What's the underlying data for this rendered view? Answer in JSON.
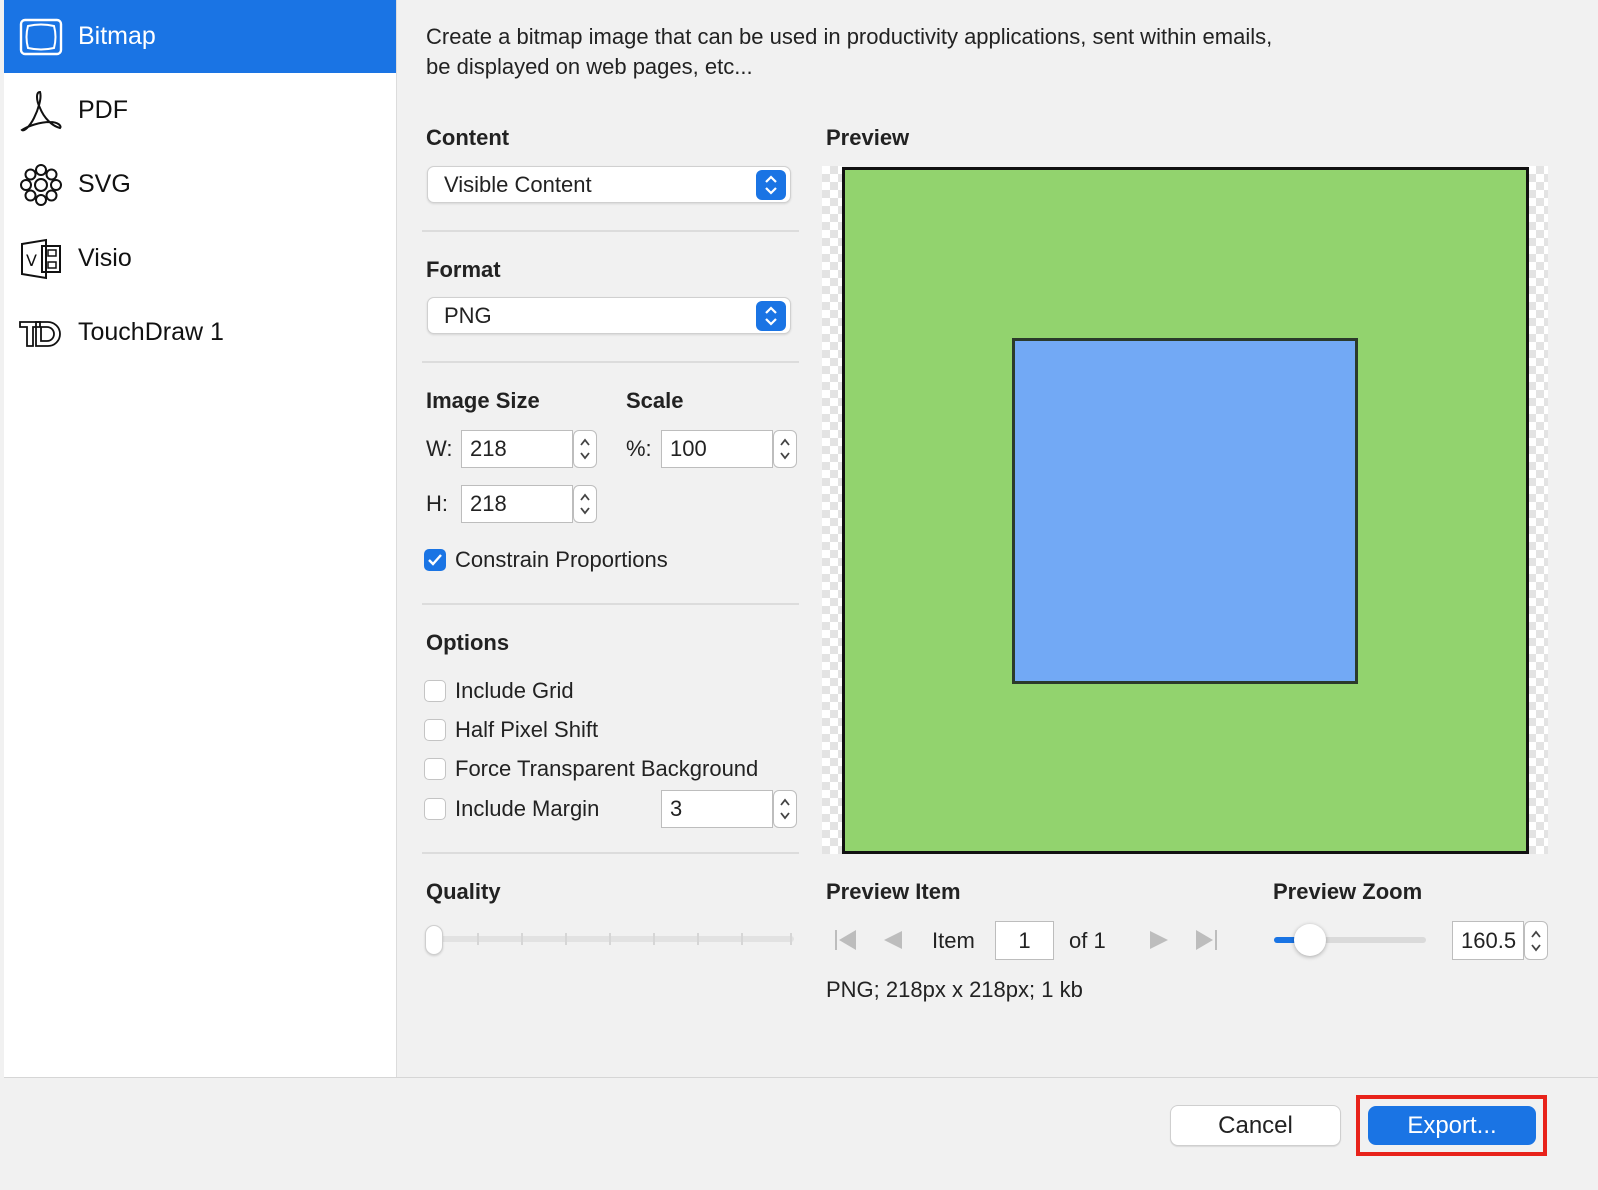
{
  "sidebar": {
    "items": [
      {
        "label": "Bitmap",
        "icon": "bitmap-frame-icon",
        "active": true
      },
      {
        "label": "PDF",
        "icon": "pdf-icon",
        "active": false
      },
      {
        "label": "SVG",
        "icon": "svg-icon",
        "active": false
      },
      {
        "label": "Visio",
        "icon": "visio-icon",
        "active": false
      },
      {
        "label": "TouchDraw 1",
        "icon": "touchdraw-icon",
        "active": false
      }
    ]
  },
  "main": {
    "description_line1": "Create a bitmap image that can be used in productivity applications, sent within emails,",
    "description_line2": "be displayed on web pages, etc...",
    "content": {
      "label": "Content",
      "value": "Visible Content"
    },
    "format": {
      "label": "Format",
      "value": "PNG"
    },
    "image_size": {
      "label": "Image Size",
      "w_label": "W:",
      "w_value": "218",
      "h_label": "H:",
      "h_value": "218"
    },
    "scale": {
      "label": "Scale",
      "pct_label": "%:",
      "pct_value": "100"
    },
    "constrain": {
      "label": "Constrain Proportions",
      "checked": true
    },
    "options": {
      "label": "Options",
      "items": [
        {
          "label": "Include Grid",
          "checked": false
        },
        {
          "label": "Half Pixel Shift",
          "checked": false
        },
        {
          "label": "Force Transparent Background",
          "checked": false
        },
        {
          "label": "Include Margin",
          "checked": false
        }
      ],
      "margin_value": "3"
    },
    "quality": {
      "label": "Quality",
      "value": 0
    }
  },
  "preview": {
    "label": "Preview",
    "colors": {
      "outer": "#92d36e",
      "inner": "#72a9f5",
      "accent": "#1a74e4"
    },
    "item_label": "Preview Item",
    "item_word": "Item",
    "item_value": "1",
    "item_of": "of 1",
    "zoom_label": "Preview Zoom",
    "zoom_value": "160.5",
    "zoom_fraction": 0.24,
    "info": "PNG; 218px x 218px; 1 kb"
  },
  "buttons": {
    "cancel": "Cancel",
    "export": "Export..."
  }
}
